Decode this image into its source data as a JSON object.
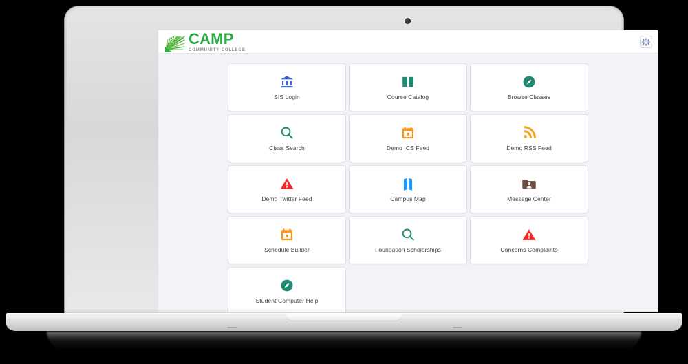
{
  "device": {
    "type": "laptop",
    "webcam": "webcam-dot"
  },
  "header": {
    "logo_name": "CAMP",
    "logo_sub": "COMMUNITY COLLEGE",
    "logo_icon": "palm-fan-icon",
    "settings_icon": "gear-icon",
    "brand_color": "#2bab45",
    "brand_sub_color": "#8d8f93"
  },
  "colors": {
    "page_background": "#f2f3f7",
    "tile_background": "#ffffff",
    "label_text": "#3d4250",
    "blue": "#3a66d8",
    "teal": "#1f8a72",
    "orange": "#f7931e",
    "amber": "#f5a623",
    "red": "#ee2b2b",
    "brown": "#6d4c41",
    "light_blue": "#2196f3"
  },
  "tiles": [
    {
      "label": "SIS Login",
      "icon": "bank-icon",
      "color": "#3a66d8"
    },
    {
      "label": "Course Catalog",
      "icon": "open-book-icon",
      "color": "#1f8a72"
    },
    {
      "label": "Browse Classes",
      "icon": "compass-icon",
      "color": "#1f8a72"
    },
    {
      "label": "Class Search",
      "icon": "magnifier-icon",
      "color": "#1f8a72"
    },
    {
      "label": "Demo ICS Feed",
      "icon": "calendar-icon",
      "color": "#f7931e"
    },
    {
      "label": "Demo RSS Feed",
      "icon": "rss-icon",
      "color": "#f5a623"
    },
    {
      "label": "Demo Twitter Feed",
      "icon": "warning-triangle-icon",
      "color": "#ee2b2b"
    },
    {
      "label": "Campus Map",
      "icon": "folded-map-icon",
      "color": "#2196f3"
    },
    {
      "label": "Message Center",
      "icon": "folder-person-icon",
      "color": "#6d4c41"
    },
    {
      "label": "Schedule Builder",
      "icon": "calendar-icon",
      "color": "#f7931e"
    },
    {
      "label": "Foundation Scholarships",
      "icon": "magnifier-icon",
      "color": "#1f8a72"
    },
    {
      "label": "Concerns Complaints",
      "icon": "warning-triangle-icon",
      "color": "#ee2b2b"
    },
    {
      "label": "Student Computer Help",
      "icon": "compass-icon",
      "color": "#1f8a72"
    }
  ]
}
